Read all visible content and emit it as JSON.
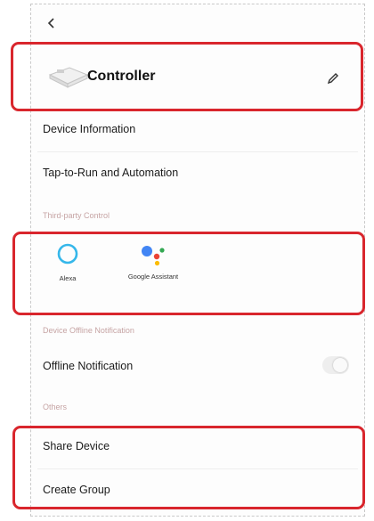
{
  "device": {
    "name": "Controller"
  },
  "menu": {
    "device_information": "Device Information",
    "tap_to_run": "Tap-to-Run and Automation"
  },
  "third_party": {
    "section_label": "Third-party Control",
    "services": [
      {
        "name": "Alexa",
        "icon": "alexa-icon"
      },
      {
        "name": "Google Assistant",
        "icon": "google-assistant-icon"
      }
    ]
  },
  "offline": {
    "section_label": "Device Offline Notification",
    "label": "Offline Notification",
    "enabled": false
  },
  "others": {
    "section_label": "Others",
    "share_device": "Share Device",
    "create_group": "Create Group"
  },
  "colors": {
    "highlight": "#d9262d",
    "alexa": "#35b7ea",
    "google_blue": "#4285f4",
    "google_red": "#ea4335",
    "google_yellow": "#fbbc05",
    "google_green": "#34a853"
  }
}
